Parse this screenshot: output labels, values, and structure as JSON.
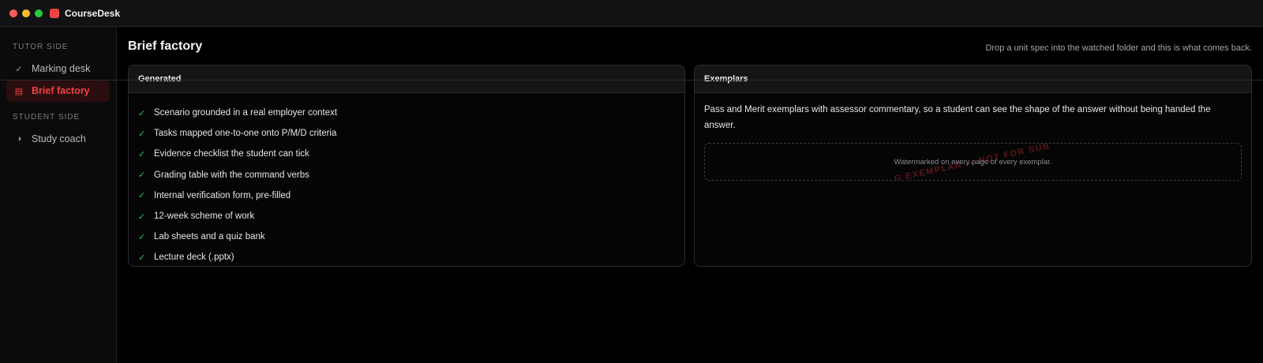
{
  "window": {
    "app_title": "CourseDesk",
    "traffic_lights": [
      "#ff5f57",
      "#febc2e",
      "#28c840"
    ]
  },
  "sidebar": {
    "sections": [
      {
        "label": "TUTOR SIDE",
        "items": [
          {
            "label": "Marking desk",
            "icon": "check-icon",
            "active": false
          },
          {
            "label": "Brief factory",
            "icon": "square-icon",
            "active": true
          }
        ]
      },
      {
        "label": "STUDENT SIDE",
        "items": [
          {
            "label": "Study coach",
            "icon": "half-circle-icon",
            "active": false
          }
        ]
      }
    ]
  },
  "main": {
    "title": "Brief factory",
    "hint": "Drop a unit spec into the watched folder and this is what comes back.",
    "generated": {
      "heading": "Generated",
      "items": [
        "Scenario grounded in a real employer context",
        "Tasks mapped one-to-one onto P/M/D criteria",
        "Evidence checklist the student can tick",
        "Grading table with the command verbs",
        "Internal verification form, pre-filled",
        "12-week scheme of work",
        "Lab sheets and a quiz bank",
        "Lecture deck (.pptx)"
      ]
    },
    "exemplars": {
      "heading": "Exemplars",
      "description": "Pass and Merit exemplars with assessor commentary, so a student can see the shape of the answer without being handed the answer.",
      "watermark_note": "Watermarked on every page of every exemplar.",
      "watermark_stamp": "G EXEMPLAR — NOT FOR SUB"
    }
  },
  "colors": {
    "accent": "#ef4444",
    "check": "#22c55e",
    "background": "#000000"
  }
}
